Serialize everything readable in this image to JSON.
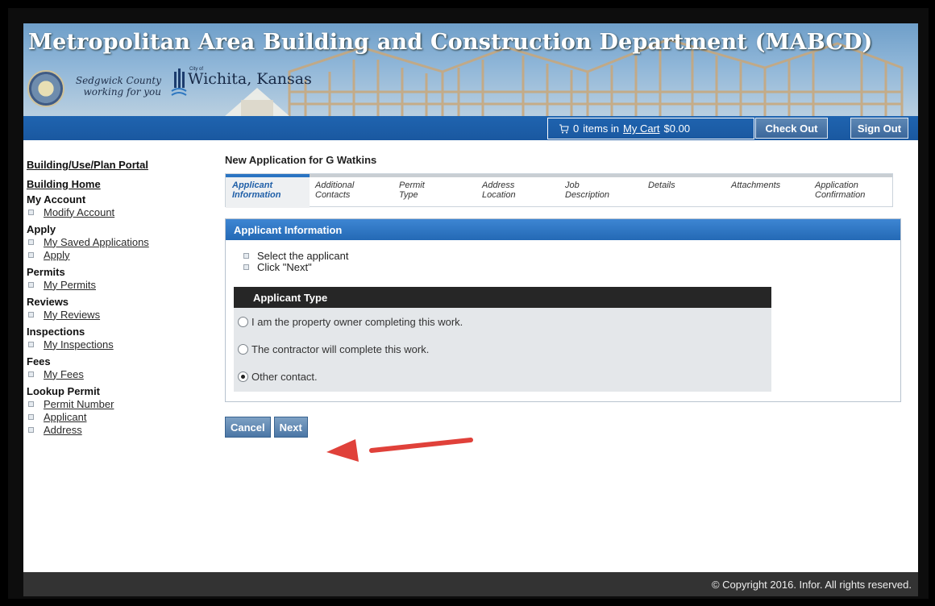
{
  "banner": {
    "title": "Metropolitan Area Building and Construction Department (MABCD)",
    "sedgwick_line1": "Sedgwick County",
    "sedgwick_line2": "working for you",
    "wichita_city_tag": "City of",
    "wichita_name": "Wichita, Kansas"
  },
  "toolbar": {
    "cart_count": "0",
    "cart_items_in": "items in",
    "cart_link": "My Cart",
    "cart_total": "$0.00",
    "checkout_label": "Check Out",
    "signout_label": "Sign Out"
  },
  "nav": {
    "portal_link": "Building/Use/Plan Portal",
    "home_link": "Building Home",
    "sections": [
      {
        "title": "My Account",
        "items": [
          "Modify Account"
        ]
      },
      {
        "title": "Apply",
        "items": [
          "My Saved Applications",
          "Apply"
        ]
      },
      {
        "title": "Permits",
        "items": [
          "My Permits"
        ]
      },
      {
        "title": "Reviews",
        "items": [
          "My Reviews"
        ]
      },
      {
        "title": "Inspections",
        "items": [
          "My Inspections"
        ]
      },
      {
        "title": "Fees",
        "items": [
          "My Fees"
        ]
      },
      {
        "title": "Lookup Permit",
        "items": [
          "Permit Number",
          "Applicant",
          "Address"
        ]
      }
    ]
  },
  "main": {
    "app_title": "New Application for G Watkins",
    "steps": [
      {
        "line1": "Applicant",
        "line2": "Information",
        "active": true
      },
      {
        "line1": "Additional",
        "line2": "Contacts",
        "active": false
      },
      {
        "line1": "Permit",
        "line2": "Type",
        "active": false
      },
      {
        "line1": "Address",
        "line2": "Location",
        "active": false
      },
      {
        "line1": "Job",
        "line2": "Description",
        "active": false
      },
      {
        "line1": "Details",
        "line2": "",
        "active": false
      },
      {
        "line1": "Attachments",
        "line2": "",
        "active": false
      },
      {
        "line1": "Application",
        "line2": "Confirmation",
        "active": false
      }
    ],
    "panel_title": "Applicant Information",
    "instructions": [
      "Select the applicant",
      "Click \"Next\""
    ],
    "applicant_type_header": "Applicant Type",
    "options": [
      {
        "label": "I am the property owner completing this work.",
        "checked": false
      },
      {
        "label": "The contractor will complete this work.",
        "checked": false
      },
      {
        "label": "Other contact.",
        "checked": true
      }
    ],
    "cancel_label": "Cancel",
    "next_label": "Next"
  },
  "footer": {
    "copyright": "© Copyright 2016. Infor. All rights reserved."
  },
  "colors": {
    "accent": "#2a74c2",
    "toolbar": "#1f64b0",
    "annotation_arrow": "#e0413a"
  }
}
